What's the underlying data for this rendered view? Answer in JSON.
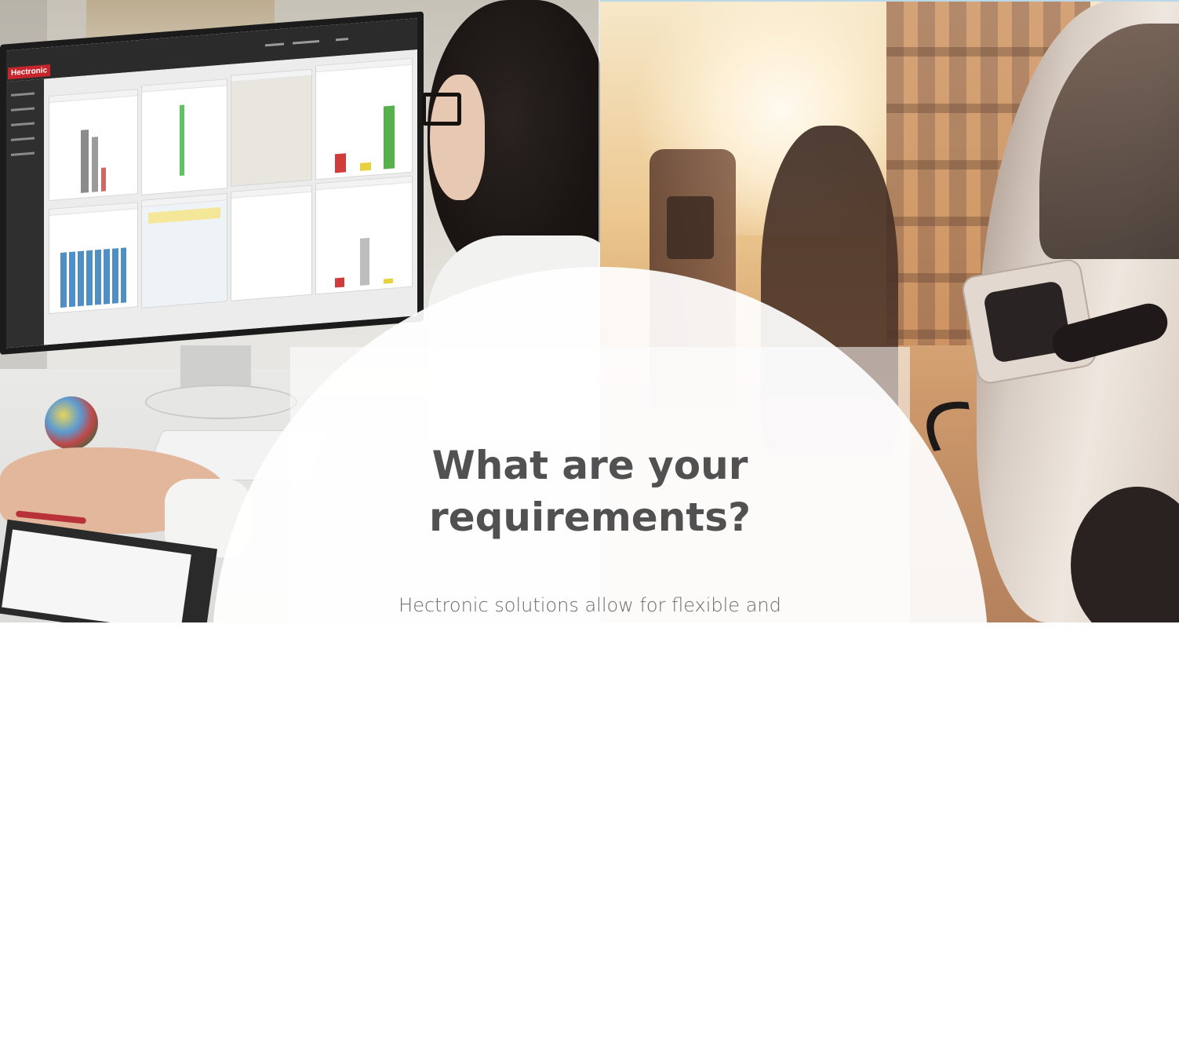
{
  "hero": {
    "headline_line1": "What are your",
    "headline_line2": "requirements?",
    "subtext": "Hectronic solutions allow for flexible and"
  },
  "monitor_app": {
    "brand": "Hectronic"
  },
  "colors": {
    "headline": "#515151",
    "subtext": "#6a6a6a",
    "overlay": "#ffffff",
    "brand_red": "#c5262b"
  },
  "images": {
    "left_photo": "person-at-monitor-dashboard",
    "right_photo": "electric-car-charging-street"
  }
}
